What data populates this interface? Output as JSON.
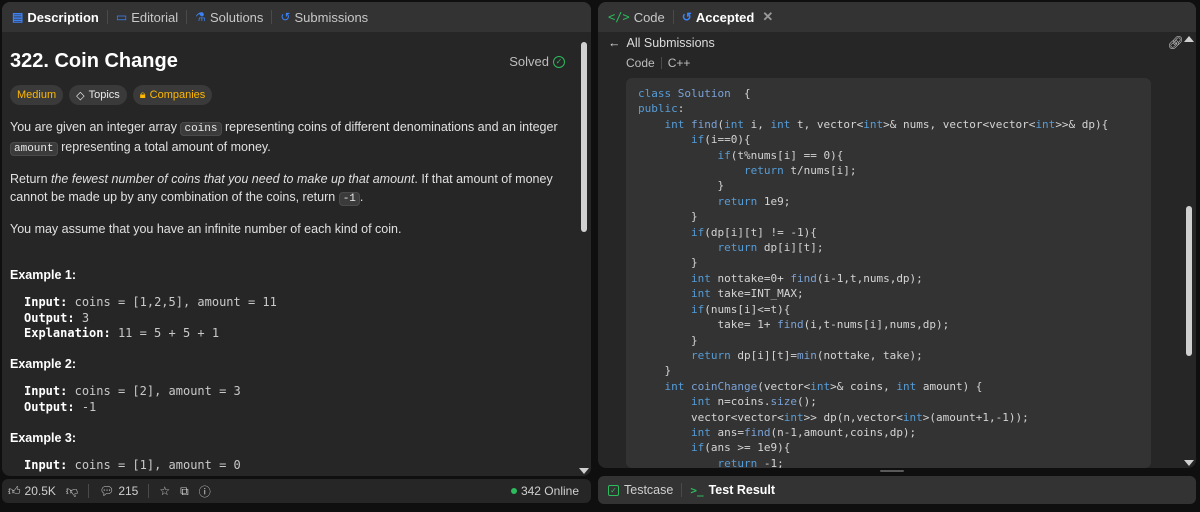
{
  "left_tabs": [
    {
      "label": "Description",
      "icon": "description-icon"
    },
    {
      "label": "Editorial",
      "icon": "editorial-icon"
    },
    {
      "label": "Solutions",
      "icon": "solutions-icon"
    },
    {
      "label": "Submissions",
      "icon": "submissions-icon"
    }
  ],
  "problem": {
    "title": "322. Coin Change",
    "status": "Solved",
    "tags": [
      "Medium",
      "Topics",
      "Companies"
    ],
    "desc1_a": "You are given an integer array ",
    "desc1_code1": "coins",
    "desc1_b": " representing coins of different denominations and an integer ",
    "desc1_code2": "amount",
    "desc1_c": " representing a total amount of money.",
    "desc2_a": "Return ",
    "desc2_em": "the fewest number of coins that you need to make up that amount",
    "desc2_b": ". If that amount of money cannot be made up by any combination of the coins, return ",
    "desc2_code": "-1",
    "desc2_c": ".",
    "desc3": "You may assume that you have an infinite number of each kind of coin."
  },
  "examples": [
    {
      "title": "Example 1:",
      "input_label": "Input:",
      "input": "coins = [1,2,5], amount = 11",
      "output_label": "Output:",
      "output": "3",
      "expl_label": "Explanation:",
      "expl": "11 = 5 + 5 + 1"
    },
    {
      "title": "Example 2:",
      "input_label": "Input:",
      "input": "coins = [2], amount = 3",
      "output_label": "Output:",
      "output": "-1"
    },
    {
      "title": "Example 3:",
      "input_label": "Input:",
      "input": "coins = [1], amount = 0"
    }
  ],
  "left_bottom": {
    "likes": "20.5K",
    "comments": "215",
    "online": "342 Online"
  },
  "right_tabs": [
    {
      "label": "Code",
      "icon": "code-icon"
    },
    {
      "label": "Accepted",
      "icon": "accepted-icon"
    }
  ],
  "submission": {
    "back_label": "All Submissions",
    "code_label": "Code",
    "language": "C++"
  },
  "code_lines": [
    [
      [
        "kw",
        "class "
      ],
      [
        "fn",
        "Solution"
      ],
      [
        "",
        "  {"
      ]
    ],
    [
      [
        "kw",
        "public"
      ],
      [
        "",
        ":"
      ]
    ],
    [
      [
        "",
        "    "
      ],
      [
        "kw",
        "int "
      ],
      [
        "fn",
        "find"
      ],
      [
        "",
        "("
      ],
      [
        "kw",
        "int "
      ],
      [
        "",
        "i, "
      ],
      [
        "kw",
        "int "
      ],
      [
        "",
        "t, vector<"
      ],
      [
        "kw",
        "int"
      ],
      [
        "",
        ">& nums, vector<vector<"
      ],
      [
        "kw",
        "int"
      ],
      [
        "",
        ">>& dp){"
      ]
    ],
    [
      [
        "",
        "        "
      ],
      [
        "kw",
        "if"
      ],
      [
        "",
        "(i==0){"
      ]
    ],
    [
      [
        "",
        "            "
      ],
      [
        "kw",
        "if"
      ],
      [
        "",
        "(t%nums[i] == 0){"
      ]
    ],
    [
      [
        "",
        "                "
      ],
      [
        "kw",
        "return "
      ],
      [
        "",
        "t/nums[i];"
      ]
    ],
    [
      [
        "",
        "            }"
      ]
    ],
    [
      [
        "",
        "            "
      ],
      [
        "kw",
        "return "
      ],
      [
        "",
        "1e9;"
      ]
    ],
    [
      [
        "",
        "        }"
      ]
    ],
    [
      [
        "",
        "        "
      ],
      [
        "kw",
        "if"
      ],
      [
        "",
        "(dp[i][t] != -1){"
      ]
    ],
    [
      [
        "",
        "            "
      ],
      [
        "kw",
        "return "
      ],
      [
        "",
        "dp[i][t];"
      ]
    ],
    [
      [
        "",
        "        }"
      ]
    ],
    [
      [
        "",
        "        "
      ],
      [
        "kw",
        "int "
      ],
      [
        "",
        "nottake=0+ "
      ],
      [
        "fn",
        "find"
      ],
      [
        "",
        "(i-1,t,nums,dp);"
      ]
    ],
    [
      [
        "",
        "        "
      ],
      [
        "kw",
        "int "
      ],
      [
        "",
        "take=INT_MAX;"
      ]
    ],
    [
      [
        "",
        "        "
      ],
      [
        "kw",
        "if"
      ],
      [
        "",
        "(nums[i]<=t){"
      ]
    ],
    [
      [
        "",
        "            take= 1+ "
      ],
      [
        "fn",
        "find"
      ],
      [
        "",
        "(i,t-nums[i],nums,dp);"
      ]
    ],
    [
      [
        "",
        "        }"
      ]
    ],
    [
      [
        "",
        "        "
      ],
      [
        "kw",
        "return "
      ],
      [
        "",
        "dp[i][t]="
      ],
      [
        "fn",
        "min"
      ],
      [
        "",
        "(nottake, take);"
      ]
    ],
    [
      [
        "",
        "    }"
      ]
    ],
    [
      [
        "",
        "    "
      ],
      [
        "kw",
        "int "
      ],
      [
        "fn",
        "coinChange"
      ],
      [
        "",
        "(vector<"
      ],
      [
        "kw",
        "int"
      ],
      [
        "",
        ">& coins, "
      ],
      [
        "kw",
        "int "
      ],
      [
        "",
        "amount) {"
      ]
    ],
    [
      [
        "",
        "        "
      ],
      [
        "kw",
        "int "
      ],
      [
        "",
        "n=coins."
      ],
      [
        "fn",
        "size"
      ],
      [
        "",
        "();"
      ]
    ],
    [
      [
        "",
        "        vector<vector<"
      ],
      [
        "kw",
        "int"
      ],
      [
        "",
        ">> dp(n,vector<"
      ],
      [
        "kw",
        "int"
      ],
      [
        "",
        ">(amount+1,-1));"
      ]
    ],
    [
      [
        "",
        "        "
      ],
      [
        "kw",
        "int "
      ],
      [
        "",
        "ans="
      ],
      [
        "fn",
        "find"
      ],
      [
        "",
        "(n-1,amount,coins,dp);"
      ]
    ],
    [
      [
        "",
        "        "
      ],
      [
        "kw",
        "if"
      ],
      [
        "",
        "(ans >= 1e9){"
      ]
    ],
    [
      [
        "",
        "            "
      ],
      [
        "kw",
        "return "
      ],
      [
        "",
        "-1;"
      ]
    ]
  ],
  "right_bottom": {
    "testcase": "Testcase",
    "test_result": "Test Result"
  },
  "colors": {
    "accent_blue": "#3b82f6",
    "accepted_green": "#2cbb5d",
    "medium_yellow": "#ffb800",
    "panel_bg": "#262626",
    "tab_bg": "#333333"
  }
}
